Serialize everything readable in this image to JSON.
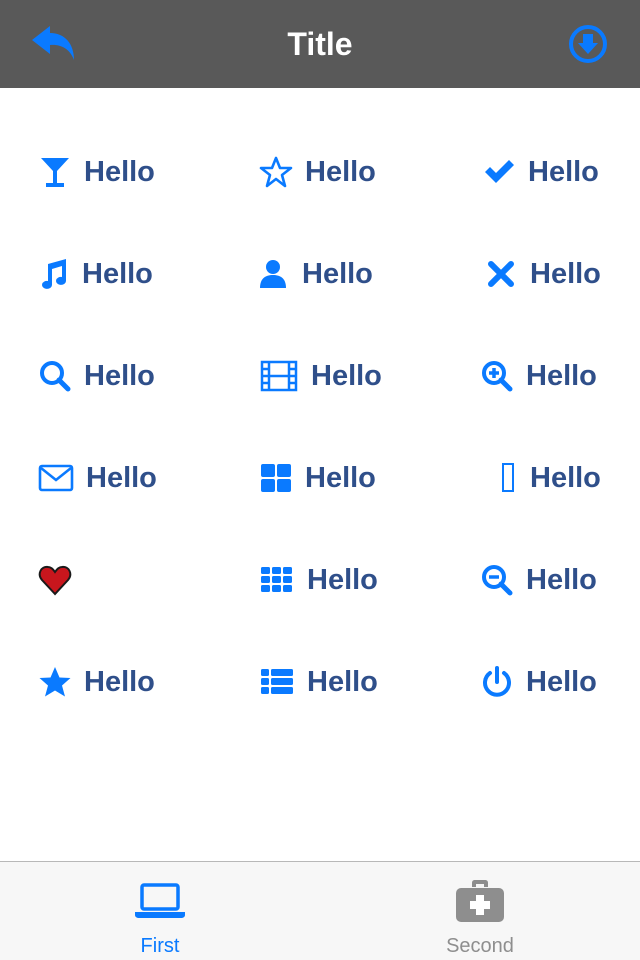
{
  "colors": {
    "accent": "#0a7aff",
    "label": "#2f4f8a",
    "navbar": "#595959",
    "tab_inactive": "#8e8e8e",
    "heart": "#c8161d"
  },
  "navbar": {
    "title": "Title",
    "left_icon": "reply-icon",
    "right_icon": "download-circle-icon"
  },
  "grid": {
    "items": [
      {
        "icon": "glass-icon",
        "label": "Hello"
      },
      {
        "icon": "star-outline-icon",
        "label": "Hello"
      },
      {
        "icon": "check-icon",
        "label": "Hello"
      },
      {
        "icon": "music-icon",
        "label": "Hello"
      },
      {
        "icon": "user-icon",
        "label": "Hello"
      },
      {
        "icon": "close-icon",
        "label": "Hello"
      },
      {
        "icon": "search-icon",
        "label": "Hello"
      },
      {
        "icon": "film-icon",
        "label": "Hello"
      },
      {
        "icon": "zoom-in-icon",
        "label": "Hello"
      },
      {
        "icon": "envelope-icon",
        "label": "Hello"
      },
      {
        "icon": "th-large-icon",
        "label": "Hello"
      },
      {
        "icon": "missing-glyph-icon",
        "label": "Hello"
      },
      {
        "icon": "heart-emoji-icon",
        "label": ""
      },
      {
        "icon": "th-icon",
        "label": "Hello"
      },
      {
        "icon": "zoom-out-icon",
        "label": "Hello"
      },
      {
        "icon": "star-icon",
        "label": "Hello"
      },
      {
        "icon": "th-list-icon",
        "label": "Hello"
      },
      {
        "icon": "power-icon",
        "label": "Hello"
      }
    ]
  },
  "tabbar": {
    "tabs": [
      {
        "label": "First",
        "icon": "laptop-icon",
        "selected": true
      },
      {
        "label": "Second",
        "icon": "medkit-icon",
        "selected": false
      }
    ]
  }
}
